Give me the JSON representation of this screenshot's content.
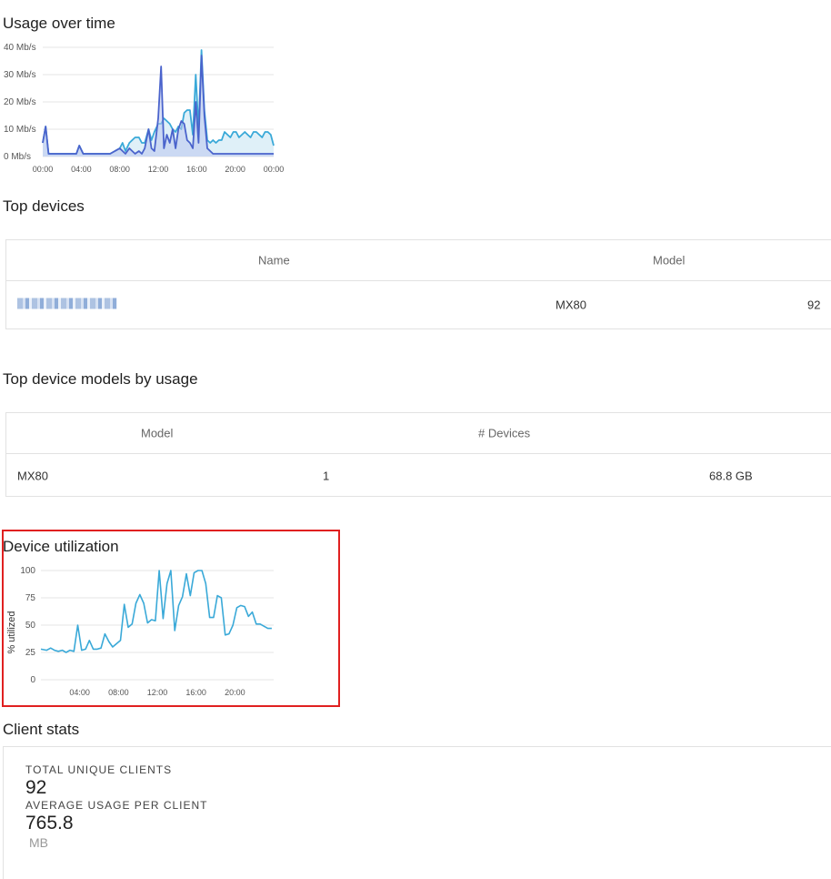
{
  "usage": {
    "title": "Usage over time",
    "y_ticks": [
      "40 Mb/s",
      "30 Mb/s",
      "20 Mb/s",
      "10 Mb/s",
      "0 Mb/s"
    ],
    "x_ticks": [
      "00:00",
      "04:00",
      "08:00",
      "12:00",
      "16:00",
      "20:00",
      "00:00"
    ],
    "colors": {
      "series_total": "#3aa9d8",
      "series_dark": "#4a63cc",
      "fill": "#dbeef7"
    }
  },
  "top_devices": {
    "title": "Top devices",
    "columns": [
      "Name",
      "Model"
    ],
    "rows": [
      {
        "name": "",
        "model": "MX80",
        "value": "92"
      }
    ]
  },
  "top_models": {
    "title": "Top device models by usage",
    "columns": [
      "Model",
      "# Devices"
    ],
    "rows": [
      {
        "model": "MX80",
        "devices": "1",
        "usage": "68.8 GB"
      }
    ]
  },
  "utilization": {
    "title": "Device utilization",
    "ylabel": "% utilized",
    "y_ticks": [
      "100",
      "75",
      "50",
      "25",
      "0"
    ],
    "x_ticks": [
      "04:00",
      "08:00",
      "12:00",
      "16:00",
      "20:00"
    ],
    "line_color": "#3aa9d8"
  },
  "client_stats": {
    "title": "Client stats",
    "total_label": "TOTAL UNIQUE CLIENTS",
    "total_value": "92",
    "avg_label": "AVERAGE USAGE PER CLIENT",
    "avg_value": "765.8",
    "avg_unit": "MB"
  },
  "chart_data": [
    {
      "type": "area",
      "title": "Usage over time",
      "xlabel": "",
      "ylabel": "",
      "ylim": [
        0,
        40
      ],
      "x_tick_labels": [
        "00:00",
        "04:00",
        "08:00",
        "12:00",
        "16:00",
        "20:00",
        "00:00"
      ],
      "x_range_hours": [
        0,
        24
      ],
      "series": [
        {
          "color": "#3aa9d8",
          "x": [
            0,
            0.3,
            0.6,
            1,
            2,
            3,
            3.5,
            3.8,
            4.2,
            5,
            6,
            7,
            7.5,
            8,
            8.3,
            8.6,
            9,
            9.3,
            9.6,
            10,
            10.3,
            10.6,
            11,
            11.3,
            11.6,
            12,
            12.3,
            12.6,
            12.9,
            13.2,
            13.5,
            13.8,
            14.1,
            14.4,
            14.7,
            15,
            15.3,
            15.6,
            15.9,
            16.2,
            16.5,
            16.8,
            17.1,
            17.4,
            17.7,
            18,
            18.3,
            18.6,
            18.9,
            19.2,
            19.5,
            19.8,
            20.1,
            20.4,
            20.7,
            21,
            21.3,
            21.6,
            21.9,
            22.2,
            22.5,
            22.8,
            23.1,
            23.4,
            23.7,
            24
          ],
          "values": [
            5,
            11,
            1,
            1,
            1,
            1,
            1,
            4,
            1,
            1,
            1,
            1,
            2,
            3,
            5,
            2,
            5,
            6,
            7,
            7,
            5,
            5,
            10,
            6,
            9,
            12,
            12,
            14,
            13,
            12,
            10,
            9,
            11,
            10,
            16,
            17,
            17,
            8,
            30,
            10,
            39,
            17,
            6,
            5,
            6,
            5,
            6,
            6,
            9,
            8,
            7,
            9,
            9,
            7,
            8,
            9,
            8,
            7,
            9,
            9,
            8,
            7,
            9,
            9,
            8,
            4
          ]
        },
        {
          "color": "#4a63cc",
          "x": [
            0,
            0.3,
            0.6,
            1,
            2,
            3,
            3.5,
            3.8,
            4.2,
            5,
            6,
            7,
            7.5,
            8,
            8.3,
            8.6,
            9,
            9.3,
            9.6,
            10,
            10.3,
            10.6,
            11,
            11.3,
            11.6,
            12,
            12.3,
            12.6,
            12.9,
            13.2,
            13.5,
            13.8,
            14.1,
            14.4,
            14.7,
            15,
            15.3,
            15.6,
            15.9,
            16.2,
            16.5,
            16.8,
            17.1,
            17.4,
            17.7,
            18,
            18.3,
            18.6,
            18.9,
            19.2,
            19.5,
            19.8,
            20.1,
            20.4,
            20.7,
            21,
            21.3,
            21.6,
            21.9,
            22.2,
            22.5,
            22.8,
            23.1,
            23.4,
            23.7,
            24
          ],
          "values": [
            5,
            11,
            1,
            1,
            1,
            1,
            1,
            4,
            1,
            1,
            1,
            1,
            2,
            3,
            2,
            1,
            3,
            2,
            1,
            2,
            1,
            3,
            10,
            3,
            2,
            14,
            33,
            3,
            8,
            5,
            10,
            3,
            10,
            13,
            12,
            6,
            5,
            3,
            20,
            5,
            37,
            15,
            3,
            2,
            1,
            1,
            1,
            1,
            1,
            1,
            1,
            1,
            1,
            1,
            1,
            1,
            1,
            1,
            1,
            1,
            1,
            1,
            1,
            1,
            1,
            1
          ]
        }
      ]
    },
    {
      "type": "line",
      "title": "Device utilization",
      "xlabel": "",
      "ylabel": "% utilized",
      "ylim": [
        0,
        100
      ],
      "x_tick_labels": [
        "04:00",
        "08:00",
        "12:00",
        "16:00",
        "20:00"
      ],
      "x_range_hours": [
        0,
        24
      ],
      "series": [
        {
          "color": "#3aa9d8",
          "x": [
            0,
            0.6,
            1,
            1.4,
            1.8,
            2.2,
            2.6,
            3,
            3.4,
            3.8,
            4.2,
            4.6,
            5,
            5.4,
            5.8,
            6.2,
            6.6,
            7,
            7.4,
            7.8,
            8.2,
            8.6,
            9,
            9.4,
            9.8,
            10.2,
            10.6,
            11,
            11.4,
            11.8,
            12.2,
            12.6,
            13,
            13.4,
            13.8,
            14.2,
            14.6,
            15,
            15.4,
            15.8,
            16.2,
            16.6,
            17,
            17.4,
            17.8,
            18.2,
            18.6,
            19,
            19.4,
            19.8,
            20.2,
            20.6,
            21,
            21.4,
            21.8,
            22.2,
            22.6,
            23,
            23.4,
            23.8
          ],
          "values": [
            28,
            27,
            29,
            27,
            26,
            27,
            25,
            27,
            26,
            50,
            27,
            28,
            36,
            28,
            28,
            29,
            42,
            35,
            30,
            33,
            36,
            69,
            48,
            51,
            70,
            78,
            70,
            52,
            55,
            54,
            100,
            56,
            88,
            100,
            45,
            68,
            76,
            97,
            77,
            98,
            100,
            100,
            88,
            57,
            57,
            77,
            75,
            41,
            42,
            50,
            66,
            68,
            67,
            58,
            62,
            51,
            51,
            49,
            47,
            47
          ]
        }
      ]
    }
  ]
}
